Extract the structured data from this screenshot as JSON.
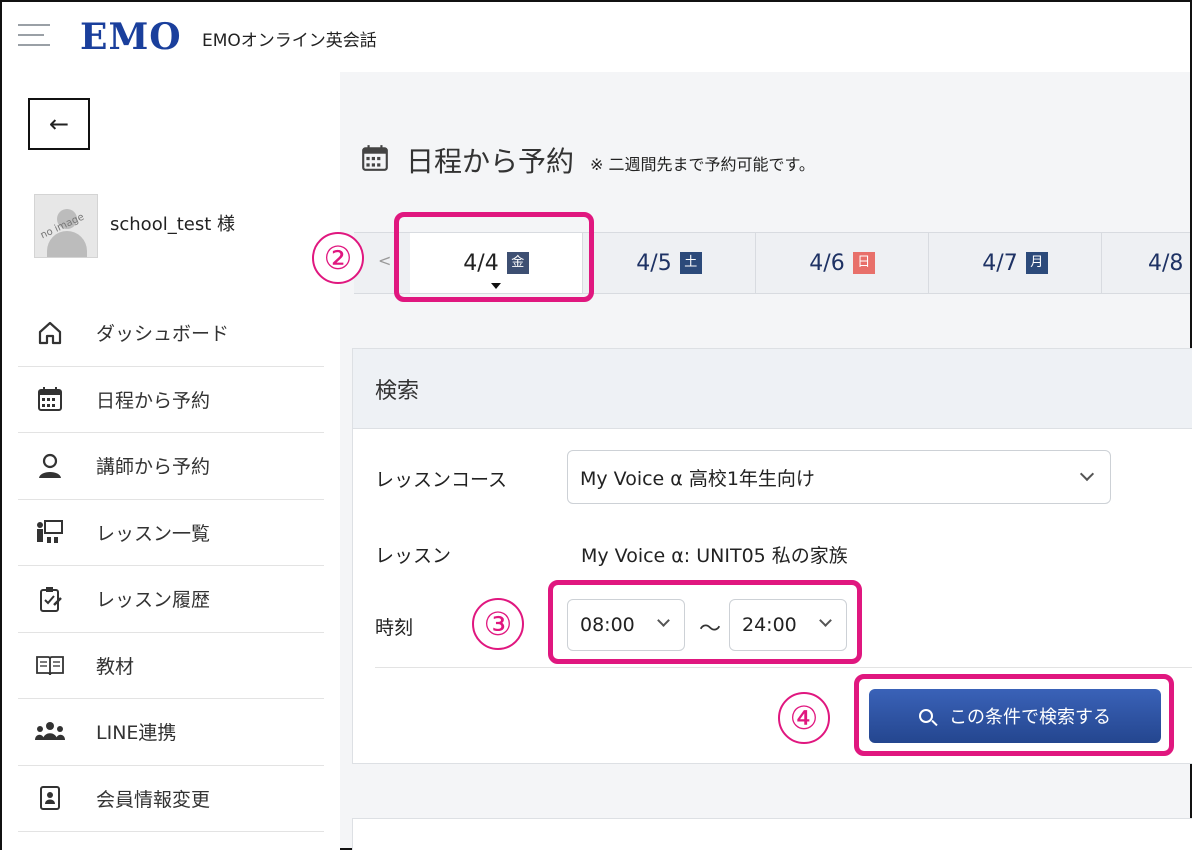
{
  "header": {
    "logo": "EMO",
    "brand": "EMOオンライン英会話"
  },
  "sidebar": {
    "back_label": "←",
    "avatar_text": "no image",
    "username": "school_test 様",
    "items": [
      {
        "label": "ダッシュボード",
        "icon": "home-icon"
      },
      {
        "label": "日程から予約",
        "icon": "calendar-icon"
      },
      {
        "label": "講師から予約",
        "icon": "teacher-icon"
      },
      {
        "label": "レッスン一覧",
        "icon": "classroom-icon"
      },
      {
        "label": "レッスン履歴",
        "icon": "clipboard-icon"
      },
      {
        "label": "教材",
        "icon": "book-icon"
      },
      {
        "label": "LINE連携",
        "icon": "group-icon"
      },
      {
        "label": "会員情報変更",
        "icon": "profile-card-icon"
      }
    ]
  },
  "main": {
    "title": "日程から予約",
    "note": "※ 二週間先まで予約可能です。",
    "date_prev": "<",
    "dates": [
      {
        "date": "4/4",
        "dow": "金",
        "active": true
      },
      {
        "date": "4/5",
        "dow": "土"
      },
      {
        "date": "4/6",
        "dow": "日"
      },
      {
        "date": "4/7",
        "dow": "月"
      },
      {
        "date": "4/8",
        "dow": ""
      }
    ],
    "search": {
      "heading": "検索",
      "course_label": "レッスンコース",
      "course_value": "My Voice α 高校1年生向け",
      "lesson_label": "レッスン",
      "lesson_value": "My Voice α: UNIT05 私の家族",
      "time_label": "時刻",
      "time_from": "08:00",
      "time_sep": "〜",
      "time_to": "24:00",
      "button": "この条件で検索する"
    }
  },
  "annotations": {
    "step2": "②",
    "step3": "③",
    "step4": "④",
    "color": "#e0177f"
  }
}
